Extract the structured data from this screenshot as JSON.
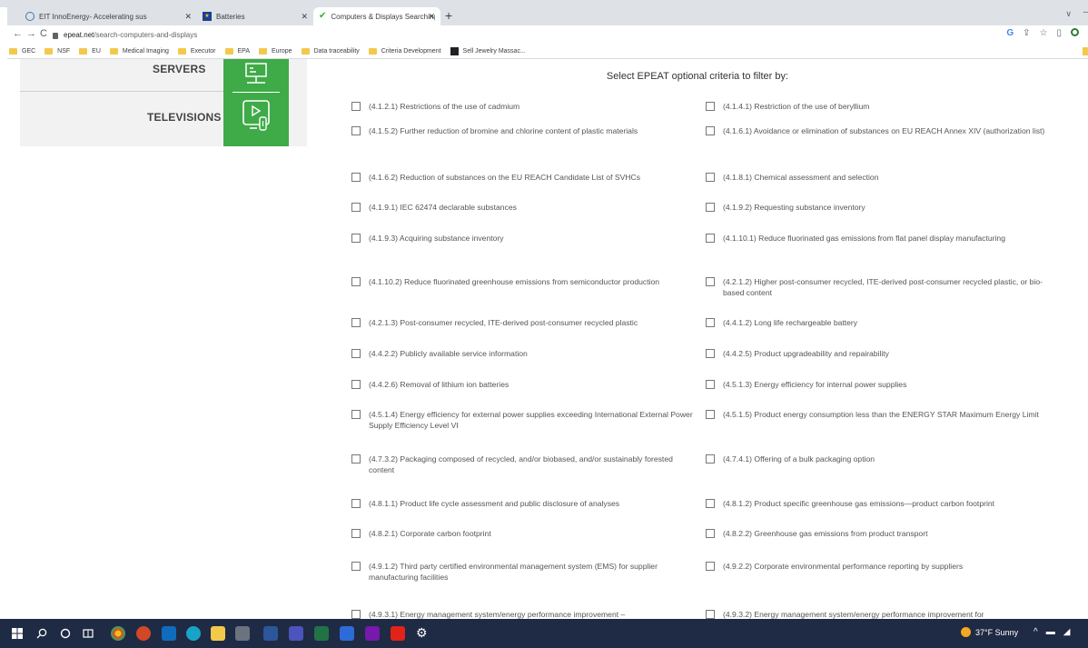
{
  "browser": {
    "tabs": [
      {
        "title": "EIT InnoEnergy- Accelerating sus",
        "icon": "edge-icon",
        "active": false
      },
      {
        "title": "Batteries",
        "icon": "eu-flag-icon",
        "active": false
      },
      {
        "title": "Computers & Displays Searching",
        "icon": "green-check-icon",
        "active": true
      }
    ],
    "new_tab": "+",
    "tab_menu": "∨",
    "url_domain": "epeat.net",
    "url_path": "/search-computers-and-displays",
    "bookmarks": [
      {
        "label": "GEC",
        "icon": "folder-icon"
      },
      {
        "label": "NSF",
        "icon": "folder-icon"
      },
      {
        "label": "EU",
        "icon": "folder-icon"
      },
      {
        "label": "Medical Imaging",
        "icon": "folder-icon"
      },
      {
        "label": "Executor",
        "icon": "folder-icon"
      },
      {
        "label": "EPA",
        "icon": "folder-icon"
      },
      {
        "label": "Europe",
        "icon": "folder-icon"
      },
      {
        "label": "Data traceability",
        "icon": "folder-icon"
      },
      {
        "label": "Criteria Development",
        "icon": "folder-icon"
      },
      {
        "label": "Sell Jewelry Massac...",
        "icon": "site-icon"
      }
    ]
  },
  "sidebar": {
    "servers_label": "SERVERS",
    "televisions_label": "TELEVISIONS",
    "accent_color": "#3faa48"
  },
  "filters": {
    "heading": "Select EPEAT optional criteria to filter by:",
    "criteria_left": [
      "(4.1.2.1) Restrictions of the use of cadmium",
      "(4.1.5.2) Further reduction of bromine and chlorine content of plastic materials",
      "(4.1.6.2) Reduction of substances on the EU REACH Candidate List of SVHCs",
      "(4.1.9.1) IEC 62474 declarable substances",
      "(4.1.9.3) Acquiring substance inventory",
      "(4.1.10.2) Reduce fluorinated greenhouse emissions from semiconductor production",
      "(4.2.1.3) Post-consumer recycled, ITE-derived post-consumer recycled plastic",
      "(4.4.2.2) Publicly available service information",
      "(4.4.2.6) Removal of lithium ion batteries",
      "(4.5.1.4) Energy efficiency for external power supplies exceeding International External Power Supply Efficiency Level VI",
      "(4.7.3.2) Packaging composed of recycled, and/or biobased, and/or sustainably forested content",
      "(4.8.1.1) Product life cycle assessment and public disclosure of analyses",
      "(4.8.2.1) Corporate carbon footprint",
      "(4.9.1.2) Third party certified environmental management system (EMS) for supplier manufacturing facilities",
      "(4.9.3.1) Energy management system/energy performance improvement –"
    ],
    "criteria_right": [
      "(4.1.4.1) Restriction of the use of beryllium",
      "(4.1.6.1) Avoidance or elimination of substances on EU REACH Annex XIV (authorization list)",
      "(4.1.8.1) Chemical assessment and selection",
      "(4.1.9.2) Requesting substance inventory",
      "(4.1.10.1) Reduce fluorinated gas emissions from flat panel display manufacturing",
      "(4.2.1.2) Higher post-consumer recycled, ITE-derived post-consumer recycled plastic, or bio-based content",
      "(4.4.1.2) Long life rechargeable battery",
      "(4.4.2.5) Product upgradeability and repairability",
      "(4.5.1.3) Energy efficiency for internal power supplies",
      "(4.5.1.5) Product energy consumption less than the ENERGY STAR Maximum Energy Limit",
      "(4.7.4.1) Offering of a bulk packaging option",
      "(4.8.1.2) Product specific greenhouse gas emissions—product carbon footprint",
      "(4.8.2.2) Greenhouse gas emissions from product transport",
      "(4.9.2.2) Corporate environmental performance reporting by suppliers",
      "(4.9.3.2) Energy management system/energy performance improvement for"
    ]
  },
  "taskbar": {
    "weather": "37°F  Sunny",
    "apps": [
      "windows-start-icon",
      "search-icon",
      "cortana-icon",
      "task-view-icon",
      "chrome-icon",
      "powerpoint-icon",
      "outlook-icon",
      "edge-icon",
      "file-explorer-icon",
      "calculator-icon",
      "word-icon",
      "teams-icon",
      "excel-icon",
      "workdocs-icon",
      "onenote-icon",
      "acrobat-icon",
      "settings-icon"
    ]
  }
}
